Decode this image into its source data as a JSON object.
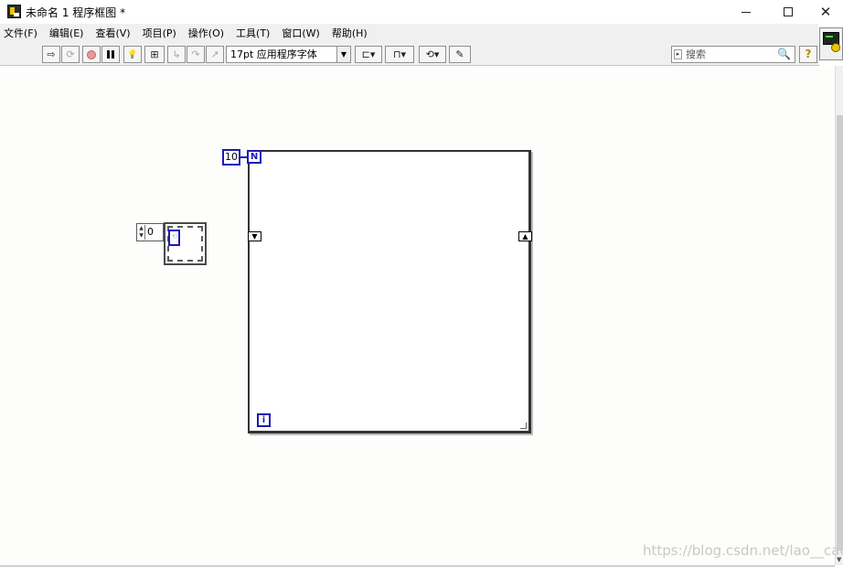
{
  "window": {
    "title": "未命名 1 程序框图 *",
    "minimize_glyph": "—",
    "maximize_glyph": "□",
    "close_glyph": "✕"
  },
  "menu": {
    "items": [
      "文件(F)",
      "编辑(E)",
      "查看(V)",
      "项目(P)",
      "操作(O)",
      "工具(T)",
      "窗口(W)",
      "帮助(H)"
    ]
  },
  "toolbar": {
    "run_glyph": "⇨",
    "run_continuously_glyph": "⟳",
    "pause_glyph": "II",
    "highlight_glyph": "💡",
    "retain_wire_glyph": "⊞",
    "step_into_glyph": "↳",
    "step_over_glyph": "↷",
    "step_out_glyph": "↗",
    "font": "17pt 应用程序字体",
    "align_glyph": "⊏▾",
    "distribute_glyph": "⊓▾",
    "reorder_glyph": "⟲▾",
    "cleanup_glyph": "✎",
    "search_placeholder": "搜索",
    "search_lead_glyph": "▸",
    "search_glyph": "🔍",
    "help_glyph": "?"
  },
  "diagram": {
    "loop_count_constant": "10",
    "n_terminal": "N",
    "i_terminal": "i",
    "shift_register_left": "▼",
    "shift_register_right": "▲",
    "array_index": "0",
    "array_cursor_glyph": "☜"
  },
  "watermark": "https://blog.csdn.net/lao__cao",
  "colors": {
    "menu_background": "#f0f0f0",
    "canvas_background": "#fdfdfb",
    "terminal_blue": "#1a1ab8",
    "loop_border": "#333333"
  },
  "icons": [
    "app-icon",
    "run-icon",
    "run-continuously-icon",
    "abort-icon",
    "pause-icon",
    "highlight-execution-icon",
    "retain-wire-values-icon",
    "step-into-icon",
    "step-over-icon",
    "step-out-icon",
    "align-icon",
    "distribute-icon",
    "reorder-icon",
    "cleanup-icon",
    "search-icon",
    "help-icon",
    "context-help-icon"
  ]
}
